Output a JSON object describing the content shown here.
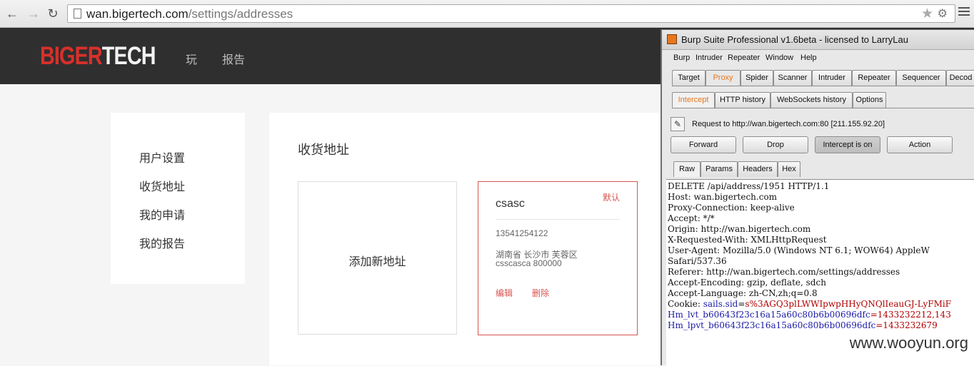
{
  "browser": {
    "url_host": "wan.bigertech.com",
    "url_path": "/settings/addresses"
  },
  "site": {
    "logo_a": "BIGER",
    "logo_b": "TECH",
    "nav": [
      "玩",
      "报告"
    ],
    "sidebar": [
      "用户设置",
      "收货地址",
      "我的申请",
      "我的报告"
    ],
    "section_title": "收货地址",
    "add_address": "添加新地址",
    "address": {
      "default_tag": "默认",
      "name": "csasc",
      "phone": "13541254122",
      "line1": "湖南省 长沙市 芙蓉区",
      "line2": "csscasca 800000",
      "edit": "编辑",
      "delete": "删除"
    }
  },
  "burp": {
    "title": "Burp Suite Professional v1.6beta - licensed to LarryLau",
    "menu": [
      "Burp",
      "Intruder",
      "Repeater",
      "Window",
      "Help"
    ],
    "tabs": [
      "Target",
      "Proxy",
      "Spider",
      "Scanner",
      "Intruder",
      "Repeater",
      "Sequencer",
      "Decod"
    ],
    "subtabs": [
      "Intercept",
      "HTTP history",
      "WebSockets history",
      "Options"
    ],
    "request_info": "Request to http://wan.bigertech.com:80  [211.155.92.20]",
    "buttons": [
      "Forward",
      "Drop",
      "Intercept is on",
      "Action"
    ],
    "view_tabs": [
      "Raw",
      "Params",
      "Headers",
      "Hex"
    ],
    "raw": {
      "l1": "DELETE /api/address/1951 HTTP/1.1",
      "l2": "Host: wan.bigertech.com",
      "l3": "Proxy-Connection: keep-alive",
      "l4": "Accept: */*",
      "l5": "Origin: http://wan.bigertech.com",
      "l6": "X-Requested-With: XMLHttpRequest",
      "l7": "User-Agent: Mozilla/5.0 (Windows NT 6.1; WOW64) AppleW",
      "l8": "Safari/537.36",
      "l9": "Referer: http://wan.bigertech.com/settings/addresses",
      "l10": "Accept-Encoding: gzip, deflate, sdch",
      "l11": "Accept-Language: zh-CN,zh;q=0.8",
      "cookie_key": "Cookie: ",
      "cookie_name": "sails.sid",
      "cookie_eq": "=",
      "cookie_val": "s%3AGQ3plLWWIpwpHHyQNQlIeauGJ-LyFMiF",
      "hm1_name": "Hm_lvt_b60643f23c16a15a60c80b6b00696dfc",
      "hm1_val": "=1433232212,143",
      "hm2_name": "Hm_lpvt_b60643f23c16a15a60c80b6b00696dfc",
      "hm2_val": "=1433232679"
    }
  },
  "watermark": "www.wooyun.org"
}
